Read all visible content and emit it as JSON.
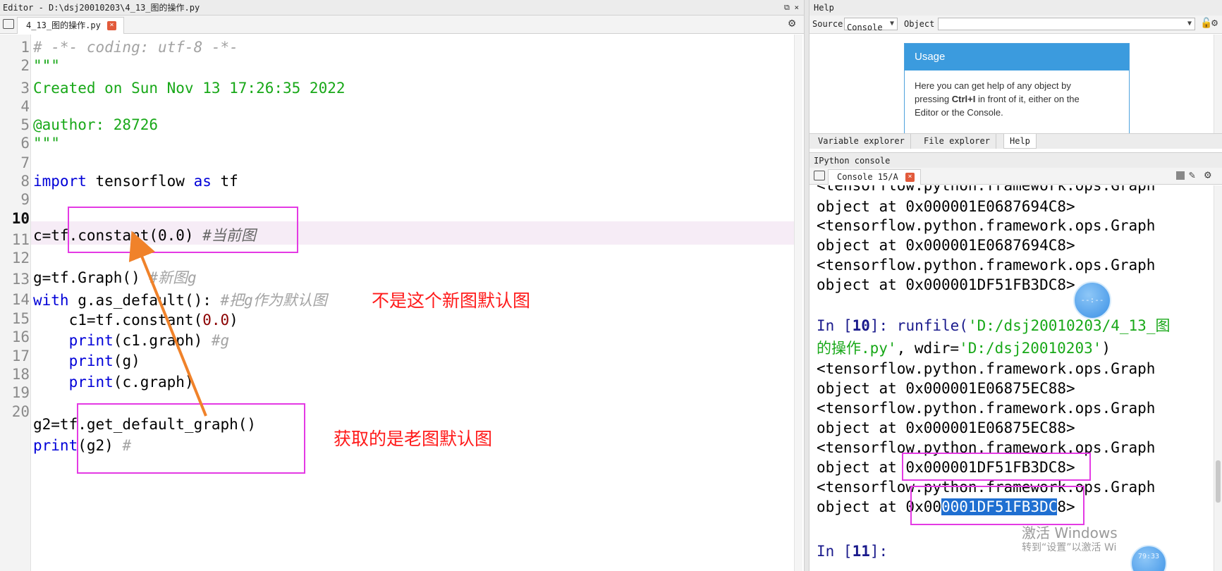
{
  "editor": {
    "title": "Editor - D:\\dsj20010203\\4_13_图的操作.py",
    "tab_label": "4_13_图的操作.py",
    "close_glyph": "×",
    "window_ctrls": "⧉ ×",
    "line_numbers": [
      "1",
      "2",
      "3",
      "4",
      "5",
      "6",
      "7",
      "8",
      "9",
      "10",
      "11",
      "12",
      "13",
      "14",
      "15",
      "16",
      "17",
      "18",
      "19",
      "20"
    ],
    "current_line": "10",
    "lines": {
      "l1": "# -*- coding: utf-8 -*-",
      "l2": "\"\"\"",
      "l3": "Created on Sun Nov 13 17:26:35 2022",
      "l5": "@author: 28726",
      "l6": "\"\"\"",
      "l8_kw1": "import",
      "l8_mid": " tensorflow ",
      "l8_kw2": "as",
      "l8_end": " tf",
      "l10_code": "c=tf.constant(0.0) ",
      "l10_comment": "#当前图",
      "l12_code": "g=tf.Graph() ",
      "l12_comment": "#新图g",
      "l13_kw": "with",
      "l13_code": " g.as_default(): ",
      "l13_comment": "#把g作为默认图",
      "l14_code": "    c1=tf.constant(",
      "l14_num": "0.0",
      "l14_end": ")",
      "l15_kw": "    print",
      "l15_code": "(c1.graph) ",
      "l15_comment": "#g",
      "l16_kw": "    print",
      "l16_code": "(g)",
      "l17_kw": "    print",
      "l17_code": "(c.graph)",
      "l19_code": "g2=tf.get_default_graph()",
      "l20_kw": "print",
      "l20_code": "(g2) ",
      "l20_comment": "#"
    },
    "annotation_1": "不是这个新图默认图",
    "annotation_2": "获取的是老图默认图",
    "annotation_color": "#ff1a1a",
    "highlight_box_color": "#e43ae4"
  },
  "help": {
    "title": "Help",
    "source_label": "Source",
    "source_value": "Console",
    "object_label": "Object",
    "usage_title": "Usage",
    "usage_text_1": "Here you can get help of any object by",
    "usage_text_2a": "pressing ",
    "usage_text_2b": "Ctrl+I",
    "usage_text_2c": " in front of it, either on the",
    "usage_text_3": "Editor or the Console.",
    "tabs": [
      "Variable explorer",
      "File explorer",
      "Help"
    ],
    "active_tab": "Help"
  },
  "console": {
    "title": "IPython console",
    "tab_label": "Console 15/A",
    "lines": {
      "c0": "<tensorflow.python.framework.ops.Graph",
      "c1": "object at 0x000001E0687694C8>",
      "c2": "<tensorflow.python.framework.ops.Graph",
      "c3": "object at 0x000001E0687694C8>",
      "c4": "<tensorflow.python.framework.ops.Graph",
      "c5": "object at 0x000001DF51FB3DC8>",
      "in10_prefix": "In [",
      "in10_num": "10",
      "in10_suffix": "]: runfile(",
      "in10_str": "'D:/dsj20010203/4_13_图",
      "in10_l2_str": "的操作.py'",
      "in10_l2_mid": ", wdir=",
      "in10_l2_str2": "'D:/dsj20010203'",
      "in10_l2_end": ")",
      "c6": "<tensorflow.python.framework.ops.Graph",
      "c7": "object at 0x000001E06875EC88>",
      "c8": "<tensorflow.python.framework.ops.Graph",
      "c9": "object at 0x000001E06875EC88>",
      "c10": "<tensorflow.python.framework.ops.Graph",
      "c11": "object at 0x000001DF51FB3DC8>",
      "c12": "<tensorflow.python.framework.ops.Graph",
      "c13_pre": "object at 0x00",
      "c13_sel": "0001DF51FB3DC",
      "c13_post": "8>",
      "in11_prefix": "In [",
      "in11_num": "11",
      "in11_suffix": "]:"
    },
    "selection_color": "#1f6fd1"
  },
  "overlay": {
    "bubble_text": "--:--",
    "bubble_time": "79:33",
    "watermark_1": "激活 Windows",
    "watermark_2": "转到“设置”以激活 Wi"
  }
}
